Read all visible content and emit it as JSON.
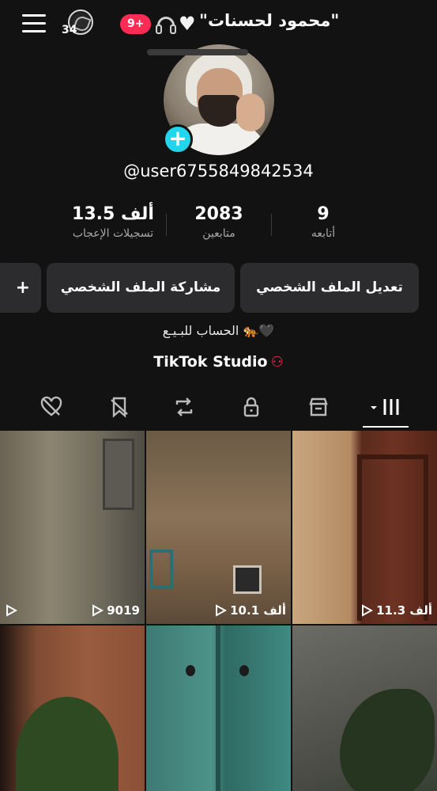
{
  "header": {
    "username_title": "\"محمود لحسنات\"",
    "notification_count": "9+",
    "quran_count": "34"
  },
  "profile": {
    "handle": "@user6755849842534",
    "stats": [
      {
        "value": "9",
        "label": "أتابعه"
      },
      {
        "value": "2083",
        "label": "متابعين"
      },
      {
        "value": "13.5 ألف",
        "label": "تسجيلات الإعجاب"
      }
    ],
    "buttons": {
      "edit": "تعديل الملف الشخصي",
      "share": "مشاركة الملف الشخصي",
      "add": "+"
    },
    "bio": "الحساب للبـيـع 🐅🖤",
    "studio": "TikTok Studio"
  },
  "videos": [
    {
      "views": "11.3 ألف"
    },
    {
      "views": "10.1 ألف"
    },
    {
      "views": "9019"
    },
    {
      "views": ""
    },
    {
      "views": ""
    },
    {
      "views": ""
    }
  ],
  "colors": {
    "background": "#121212",
    "accent_red": "#fe2c55",
    "accent_cyan": "#20d5ec",
    "button_bg": "#2c2c2e"
  }
}
